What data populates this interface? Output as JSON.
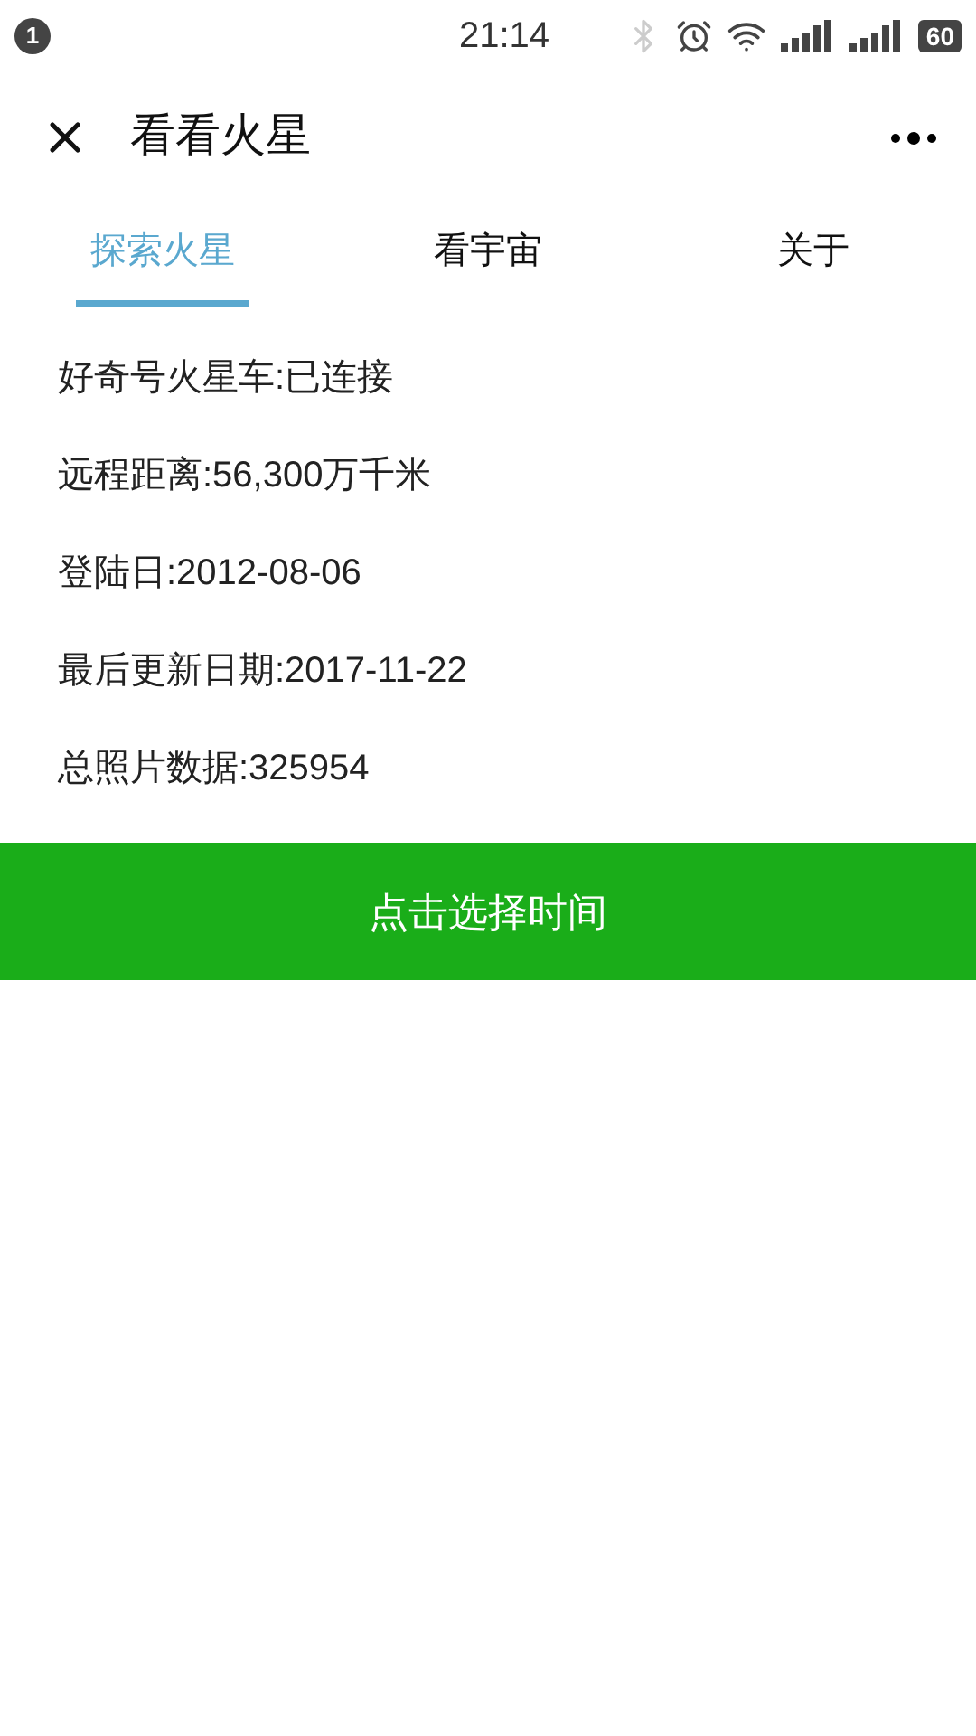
{
  "status_bar": {
    "notification_count": "1",
    "time": "21:14",
    "battery": "60"
  },
  "nav_bar": {
    "title": "看看火星"
  },
  "tabs": [
    {
      "label": "探索火星",
      "selected": true
    },
    {
      "label": "看宇宙",
      "selected": false
    },
    {
      "label": "关于",
      "selected": false
    }
  ],
  "info_lines": [
    "好奇号火星车:已连接",
    "远程距离:56,300万千米",
    "登陆日:2012-08-06",
    "最后更新日期:2017-11-22",
    "总照片数据:325954"
  ],
  "action_button": {
    "label": "点击选择时间"
  }
}
